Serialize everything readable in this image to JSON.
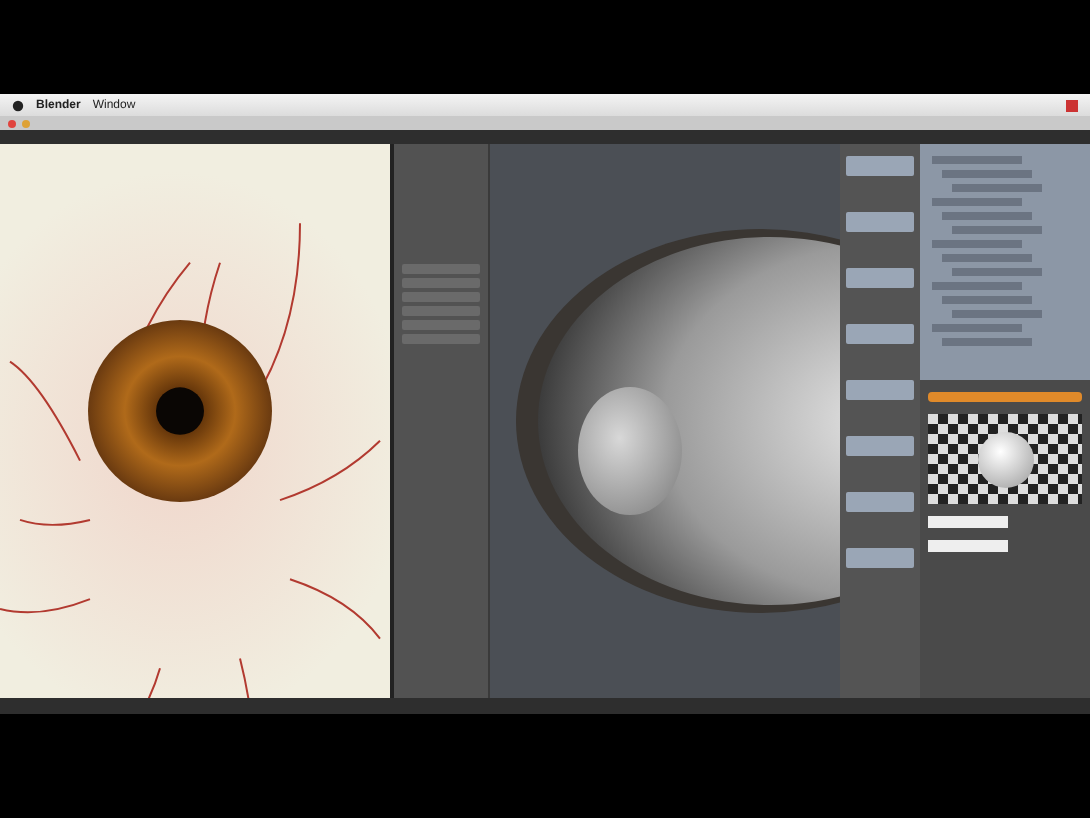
{
  "menu_bar": {
    "items": [
      "Blender",
      "Window"
    ]
  }
}
